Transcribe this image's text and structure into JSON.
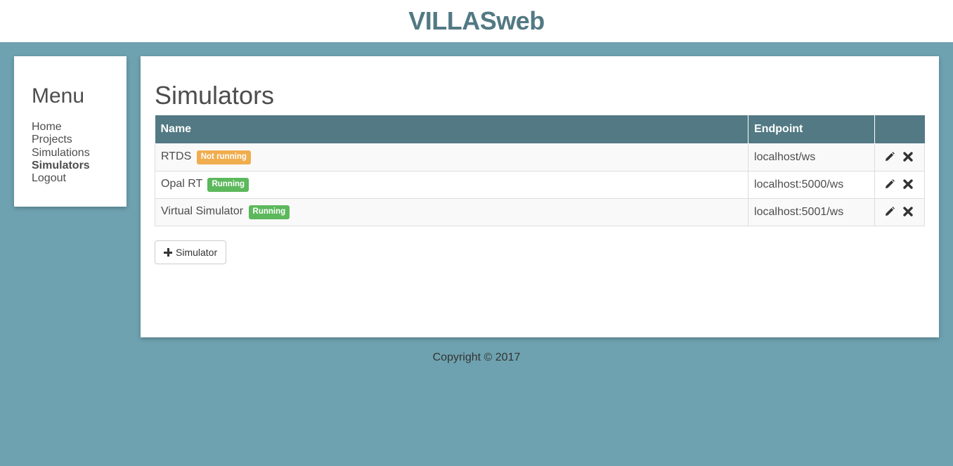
{
  "header": {
    "title": "VILLASweb"
  },
  "menu": {
    "title": "Menu",
    "items": [
      {
        "label": "Home",
        "active": false
      },
      {
        "label": "Projects",
        "active": false
      },
      {
        "label": "Simulations",
        "active": false
      },
      {
        "label": "Simulators",
        "active": true
      },
      {
        "label": "Logout",
        "active": false
      }
    ]
  },
  "page": {
    "title": "Simulators",
    "table": {
      "columns": [
        "Name",
        "Endpoint",
        ""
      ],
      "rows": [
        {
          "name": "RTDS",
          "status": "Not running",
          "status_type": "warning",
          "endpoint": "localhost/ws"
        },
        {
          "name": "Opal RT",
          "status": "Running",
          "status_type": "success",
          "endpoint": "localhost:5000/ws"
        },
        {
          "name": "Virtual Simulator",
          "status": "Running",
          "status_type": "success",
          "endpoint": "localhost:5001/ws"
        }
      ]
    },
    "add_button_label": "Simulator"
  },
  "footer": {
    "text": "Copyright © 2017"
  },
  "colors": {
    "header_text": "#527984",
    "background": "#6ea2b0",
    "table_header": "#527984",
    "badge_warning": "#f0ad4e",
    "badge_success": "#5cb85c"
  },
  "icons": {
    "edit": "pencil-icon",
    "delete": "remove-icon",
    "add": "plus-icon"
  }
}
